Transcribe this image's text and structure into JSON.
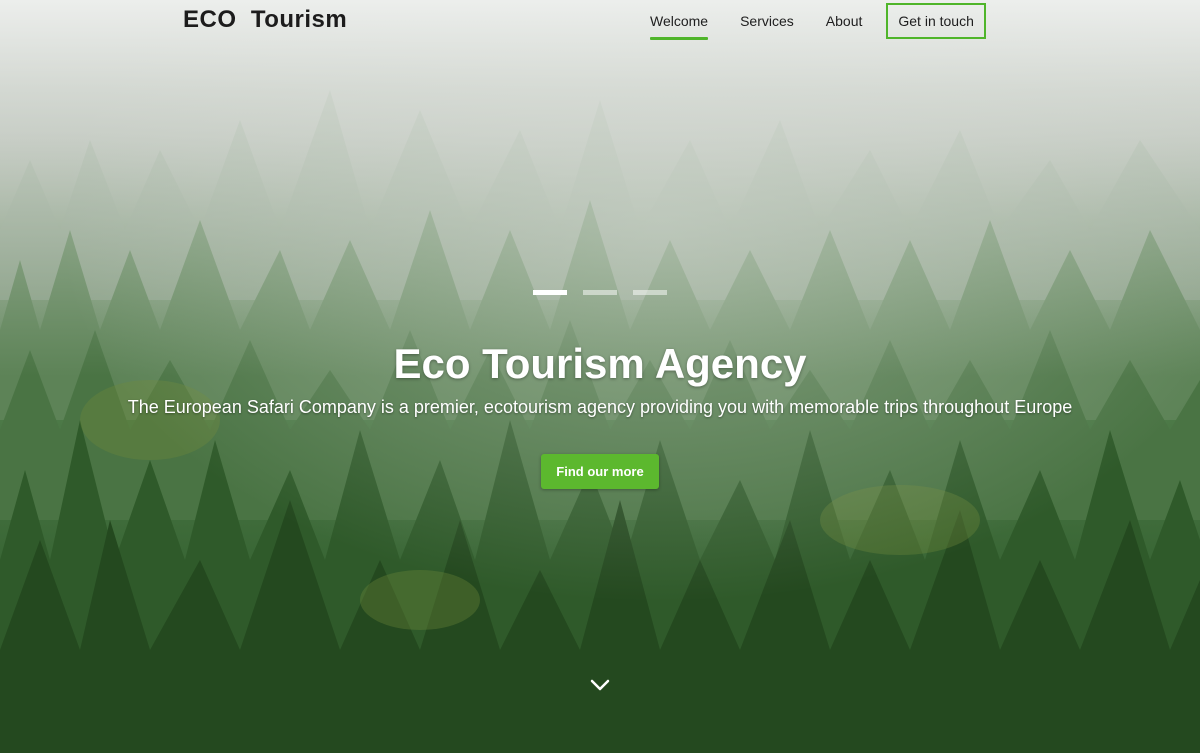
{
  "header": {
    "logo_text": "ECO  Tourism",
    "nav": [
      {
        "label": "Welcome",
        "active": true
      },
      {
        "label": "Services",
        "active": false
      },
      {
        "label": "About",
        "active": false
      }
    ],
    "cta_label": "Get in touch"
  },
  "hero": {
    "title": "Eco Tourism Agency",
    "subtitle": "The European Safari Company is a premier, ecotourism agency providing you with memorable trips throughout Europe",
    "button_label": "Find our more",
    "slides": {
      "count": 3,
      "active_index": 0
    },
    "scroll_icon": "chevron-down-icon"
  },
  "colors": {
    "accent": "#4fb52a",
    "button": "#5cb82e",
    "text_dark": "#1e1e1e",
    "text_light": "#ffffff"
  }
}
